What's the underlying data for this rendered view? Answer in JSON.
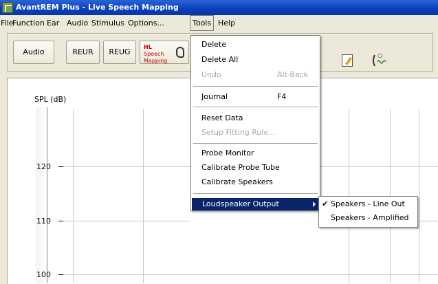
{
  "window": {
    "title": "AvantREM Plus - Live Speech Mapping"
  },
  "menubar": {
    "items": [
      "File",
      "Function",
      "Ear",
      "Audio",
      "Stimulus",
      "Options...",
      "Tools",
      "Help"
    ]
  },
  "toolbar": {
    "audio": "Audio",
    "reur": "REUR",
    "reug": "REUG",
    "hl": "HL",
    "speech": "Speech",
    "mapping": "Mapping"
  },
  "graph": {
    "y_label": "SPL (dB)",
    "ticks": [
      "120",
      "110",
      "100"
    ]
  },
  "tools_menu": {
    "delete": "Delete",
    "delete_all": "Delete All",
    "undo": "Undo",
    "undo_shortcut": "Alt-Back",
    "journal": "Journal",
    "journal_shortcut": "F4",
    "reset_data": "Reset Data",
    "setup_fitting_rule": "Setup Fitting Rule...",
    "probe_monitor": "Probe Monitor",
    "calibrate_probe_tube": "Calibrate Probe Tube",
    "calibrate_speakers": "Calibrate Speakers",
    "loudspeaker_output": "Loudspeaker Output"
  },
  "loudspeaker_submenu": {
    "line_out": "Speakers - Line Out",
    "amplified": "Speakers - Amplified",
    "selected": "Speakers - Line Out"
  },
  "colors": {
    "highlight": "#0a246a",
    "title_bar": "#0a3fb9"
  }
}
